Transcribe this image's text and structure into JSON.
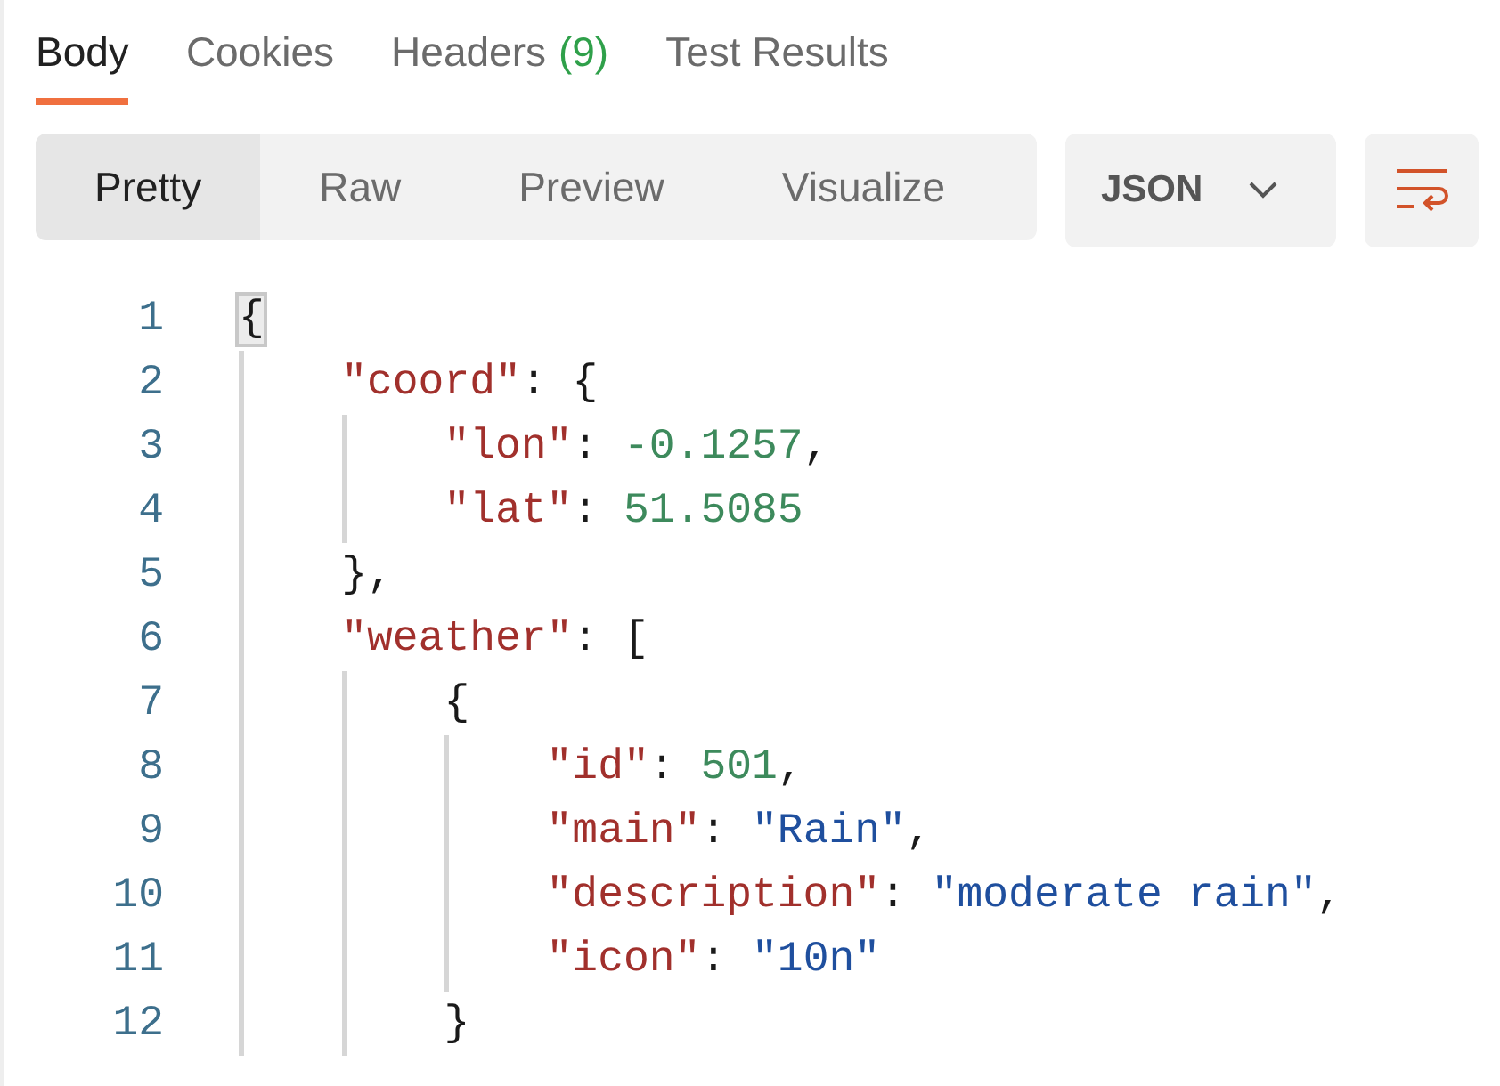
{
  "tabs": [
    {
      "label": "Body",
      "selected": true
    },
    {
      "label": "Cookies",
      "selected": false
    },
    {
      "label": "Headers",
      "count": "(9)",
      "selected": false
    },
    {
      "label": "Test Results",
      "selected": false
    }
  ],
  "view_modes": [
    {
      "label": "Pretty",
      "selected": true
    },
    {
      "label": "Raw",
      "selected": false
    },
    {
      "label": "Preview",
      "selected": false
    },
    {
      "label": "Visualize",
      "selected": false
    }
  ],
  "format_dropdown": {
    "value": "JSON"
  },
  "editor": {
    "lines": [
      {
        "number": "1",
        "bracket_highlighted": true,
        "tokens": [
          {
            "kind": "punct",
            "text": "{"
          }
        ],
        "children": [
          {
            "number": "2",
            "tokens": [
              {
                "kind": "key",
                "text": "\"coord\""
              },
              {
                "kind": "punct",
                "text": ": {"
              }
            ],
            "children": [
              {
                "number": "3",
                "tokens": [
                  {
                    "kind": "key",
                    "text": "\"lon\""
                  },
                  {
                    "kind": "punct",
                    "text": ": "
                  },
                  {
                    "kind": "number",
                    "text": "-0.1257"
                  },
                  {
                    "kind": "punct",
                    "text": ","
                  }
                ]
              },
              {
                "number": "4",
                "tokens": [
                  {
                    "kind": "key",
                    "text": "\"lat\""
                  },
                  {
                    "kind": "punct",
                    "text": ": "
                  },
                  {
                    "kind": "number",
                    "text": "51.5085"
                  }
                ]
              }
            ]
          },
          {
            "number": "5",
            "tokens": [
              {
                "kind": "punct",
                "text": "},"
              }
            ]
          },
          {
            "number": "6",
            "tokens": [
              {
                "kind": "key",
                "text": "\"weather\""
              },
              {
                "kind": "punct",
                "text": ": ["
              }
            ],
            "children": [
              {
                "number": "7",
                "tokens": [
                  {
                    "kind": "punct",
                    "text": "{"
                  }
                ],
                "children": [
                  {
                    "number": "8",
                    "tokens": [
                      {
                        "kind": "key",
                        "text": "\"id\""
                      },
                      {
                        "kind": "punct",
                        "text": ": "
                      },
                      {
                        "kind": "number",
                        "text": "501"
                      },
                      {
                        "kind": "punct",
                        "text": ","
                      }
                    ]
                  },
                  {
                    "number": "9",
                    "tokens": [
                      {
                        "kind": "key",
                        "text": "\"main\""
                      },
                      {
                        "kind": "punct",
                        "text": ": "
                      },
                      {
                        "kind": "string",
                        "text": "\"Rain\""
                      },
                      {
                        "kind": "punct",
                        "text": ","
                      }
                    ]
                  },
                  {
                    "number": "10",
                    "tokens": [
                      {
                        "kind": "key",
                        "text": "\"description\""
                      },
                      {
                        "kind": "punct",
                        "text": ": "
                      },
                      {
                        "kind": "string",
                        "text": "\"moderate rain\""
                      },
                      {
                        "kind": "punct",
                        "text": ","
                      }
                    ]
                  },
                  {
                    "number": "11",
                    "tokens": [
                      {
                        "kind": "key",
                        "text": "\"icon\""
                      },
                      {
                        "kind": "punct",
                        "text": ": "
                      },
                      {
                        "kind": "string",
                        "text": "\"10n\""
                      }
                    ]
                  }
                ]
              },
              {
                "number": "12",
                "tokens": [
                  {
                    "kind": "punct",
                    "text": "}"
                  }
                ]
              }
            ]
          }
        ]
      }
    ]
  }
}
